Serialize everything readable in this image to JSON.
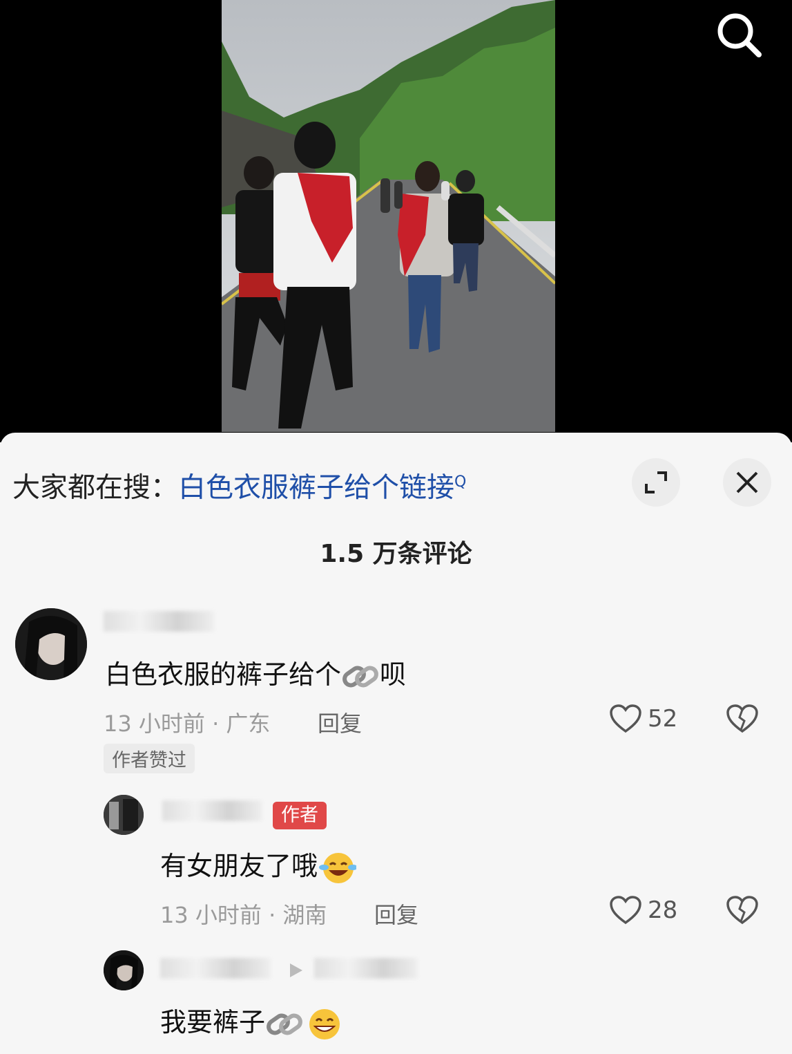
{
  "video": {
    "search_icon": "search-icon"
  },
  "search_suggest": {
    "prefix": "大家都在搜：",
    "query": "白色衣服裤子给个链接",
    "query_icon": "Q"
  },
  "header": {
    "comment_count": "1.5 万条评论",
    "expand_icon": "expand-icon",
    "close_icon": "close-icon"
  },
  "comments": [
    {
      "text": "白色衣服的裤子给个",
      "text_suffix": "呗",
      "meta": "13 小时前 · 广东",
      "reply_label": "回复",
      "likes": "52",
      "badge": "作者赞过"
    },
    {
      "author_tag": "作者",
      "text": "有女朋友了哦",
      "meta": "13 小时前 · 湖南",
      "reply_label": "回复",
      "likes": "28"
    },
    {
      "text": "我要裤子"
    }
  ],
  "colors": {
    "link_blue": "#1f4fa8",
    "author_red": "#e04848",
    "sheet_bg": "#f6f6f6"
  }
}
